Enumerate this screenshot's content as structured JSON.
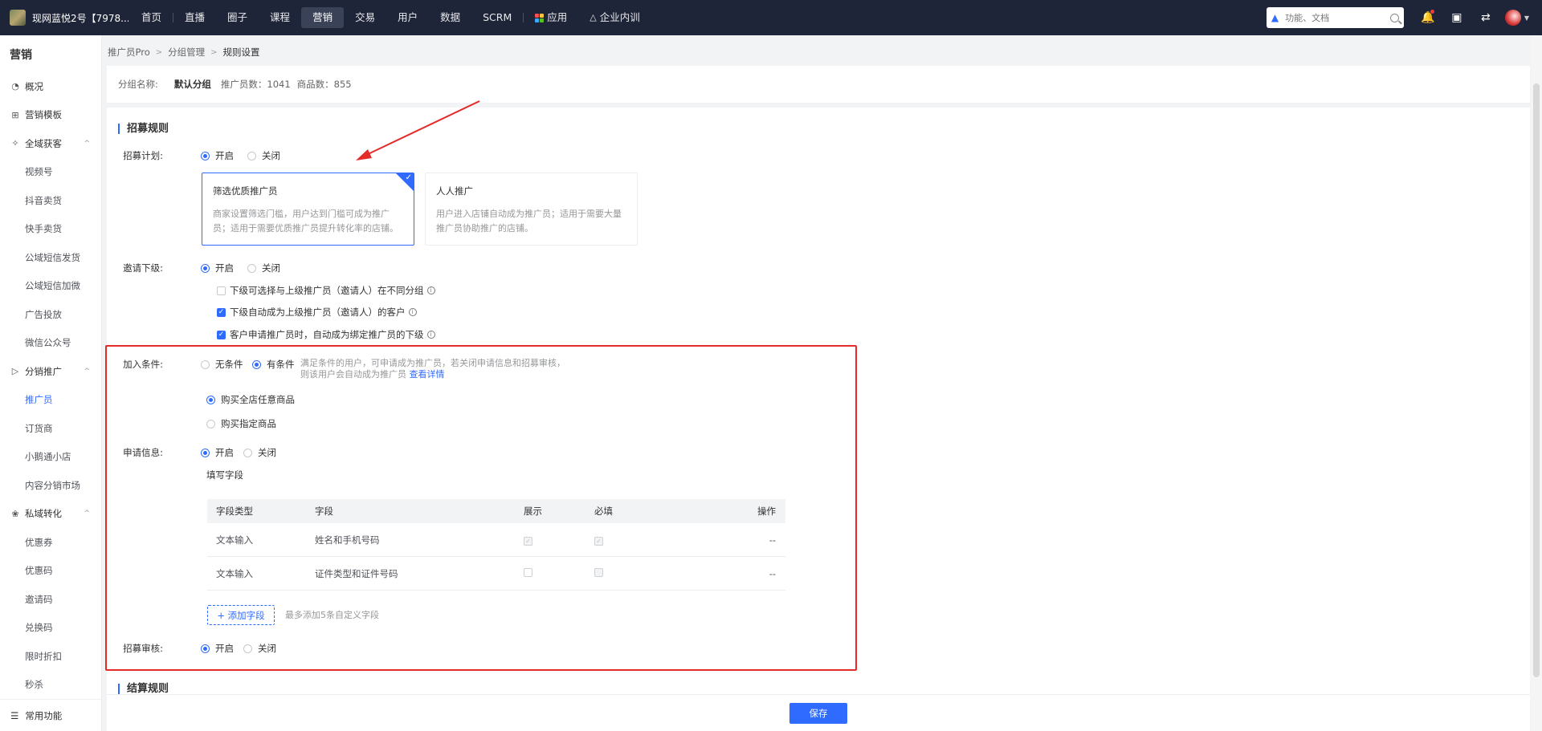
{
  "topbar": {
    "shop_name": "现网蓝悦2号【7978...",
    "nav": [
      {
        "label": "首页"
      },
      {
        "label": "直播"
      },
      {
        "label": "圈子"
      },
      {
        "label": "课程"
      },
      {
        "label": "营销"
      },
      {
        "label": "交易"
      },
      {
        "label": "用户"
      },
      {
        "label": "数据"
      },
      {
        "label": "SCRM"
      },
      {
        "label": "应用"
      },
      {
        "label": "企业内训"
      }
    ],
    "active_nav": "营销",
    "search_placeholder": "功能、文档"
  },
  "sidebar": {
    "title": "营销",
    "items": [
      {
        "label": "概况",
        "icon": "pie-chart-icon"
      },
      {
        "label": "营销模板",
        "icon": "grid-icon"
      },
      {
        "label": "全域获客",
        "icon": "share-icon"
      },
      {
        "label": "视频号"
      },
      {
        "label": "抖音卖货"
      },
      {
        "label": "快手卖货"
      },
      {
        "label": "公域短信发货"
      },
      {
        "label": "公域短信加微"
      },
      {
        "label": "广告投放"
      },
      {
        "label": "微信公众号"
      },
      {
        "label": "分销推广",
        "icon": "megaphone-icon"
      },
      {
        "label": "推广员"
      },
      {
        "label": "订货商"
      },
      {
        "label": "小鹅通小店"
      },
      {
        "label": "内容分销市场"
      },
      {
        "label": "私域转化",
        "icon": "flower-icon"
      },
      {
        "label": "优惠券"
      },
      {
        "label": "优惠码"
      },
      {
        "label": "邀请码"
      },
      {
        "label": "兑换码"
      },
      {
        "label": "限时折扣"
      },
      {
        "label": "秒杀"
      }
    ],
    "footer": "常用功能"
  },
  "breadcrumb": [
    "推广员Pro",
    "分组管理",
    "规则设置"
  ],
  "group_info": {
    "name_label": "分组名称:",
    "name_value": "默认分组",
    "promoter_count": "推广员数：1041",
    "product_count": "商品数：855"
  },
  "recruit": {
    "section_title": "招募规则",
    "plan_label": "招募计划:",
    "on": "开启",
    "off": "关闭",
    "card1_title": "筛选优质推广员",
    "card1_desc": "商家设置筛选门槛，用户达到门槛可成为推广员；适用于需要优质推广员提升转化率的店铺。",
    "card2_title": "人人推广",
    "card2_desc": "用户进入店铺自动成为推广员；适用于需要大量推广员协助推广的店铺。",
    "invite_label": "邀请下级:",
    "check1": "下级可选择与上级推广员（邀请人）在不同分组",
    "check2": "下级自动成为上级推广员（邀请人）的客户",
    "check3": "客户申请推广员时，自动成为绑定推广员的下级",
    "join_label": "加入条件:",
    "no_condition": "无条件",
    "has_condition": "有条件",
    "join_hint_1": "满足条件的用户，可申请成为推广员，若关闭申请信息和招募审核，",
    "join_hint_2": "则该用户会自动成为推广员",
    "join_hint_link": "查看详情",
    "buy_any": "购买全店任意商品",
    "buy_specific": "购买指定商品",
    "apply_label": "申请信息:",
    "fill_fields": "填写字段",
    "table_headers": [
      "字段类型",
      "字段",
      "展示",
      "必填",
      "操作"
    ],
    "table_rows": [
      {
        "type": "文本输入",
        "field": "姓名和手机号码",
        "op": "--"
      },
      {
        "type": "文本输入",
        "field": "证件类型和证件号码",
        "op": "--"
      }
    ],
    "add_field": "+ 添加字段",
    "add_field_hint": "最多添加5条自定义字段",
    "review_label": "招募审核:"
  },
  "settlement": {
    "section_title": "结算规则"
  },
  "save_label": "保存",
  "colors": {
    "accent": "#2f6bff",
    "annotation": "#e52a2a",
    "topbar": "#1f2538"
  }
}
